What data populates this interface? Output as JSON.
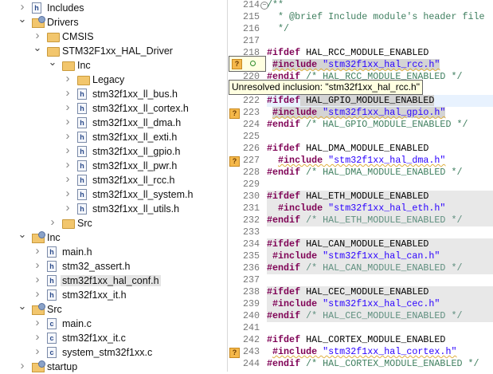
{
  "tree": [
    {
      "label": "Includes",
      "level": 0,
      "expanded": false,
      "icon": "includes-icon"
    },
    {
      "label": "Drivers",
      "level": 0,
      "expanded": true,
      "icon": "source-folder-icon"
    },
    {
      "label": "CMSIS",
      "level": 1,
      "expanded": false,
      "icon": "folder-icon"
    },
    {
      "label": "STM32F1xx_HAL_Driver",
      "level": 1,
      "expanded": true,
      "icon": "folder-icon"
    },
    {
      "label": "Inc",
      "level": 2,
      "expanded": true,
      "icon": "folder-icon"
    },
    {
      "label": "Legacy",
      "level": 3,
      "expanded": false,
      "icon": "folder-icon"
    },
    {
      "label": "stm32f1xx_ll_bus.h",
      "level": 3,
      "expanded": false,
      "icon": "header-file-icon"
    },
    {
      "label": "stm32f1xx_ll_cortex.h",
      "level": 3,
      "expanded": false,
      "icon": "header-file-icon"
    },
    {
      "label": "stm32f1xx_ll_dma.h",
      "level": 3,
      "expanded": false,
      "icon": "header-file-icon"
    },
    {
      "label": "stm32f1xx_ll_exti.h",
      "level": 3,
      "expanded": false,
      "icon": "header-file-icon"
    },
    {
      "label": "stm32f1xx_ll_gpio.h",
      "level": 3,
      "expanded": false,
      "icon": "header-file-icon"
    },
    {
      "label": "stm32f1xx_ll_pwr.h",
      "level": 3,
      "expanded": false,
      "icon": "header-file-icon"
    },
    {
      "label": "stm32f1xx_ll_rcc.h",
      "level": 3,
      "expanded": false,
      "icon": "header-file-icon"
    },
    {
      "label": "stm32f1xx_ll_system.h",
      "level": 3,
      "expanded": false,
      "icon": "header-file-icon"
    },
    {
      "label": "stm32f1xx_ll_utils.h",
      "level": 3,
      "expanded": false,
      "icon": "header-file-icon"
    },
    {
      "label": "Src",
      "level": 2,
      "expanded": false,
      "icon": "folder-icon"
    },
    {
      "label": "Inc",
      "level": 0,
      "expanded": true,
      "icon": "source-folder-icon"
    },
    {
      "label": "main.h",
      "level": 1,
      "expanded": false,
      "icon": "header-file-icon"
    },
    {
      "label": "stm32_assert.h",
      "level": 1,
      "expanded": false,
      "icon": "header-file-icon"
    },
    {
      "label": "stm32f1xx_hal_conf.h",
      "level": 1,
      "expanded": false,
      "icon": "header-file-icon",
      "selected": true
    },
    {
      "label": "stm32f1xx_it.h",
      "level": 1,
      "expanded": false,
      "icon": "header-file-icon"
    },
    {
      "label": "Src",
      "level": 0,
      "expanded": true,
      "icon": "source-folder-icon"
    },
    {
      "label": "main.c",
      "level": 1,
      "expanded": false,
      "icon": "c-file-icon"
    },
    {
      "label": "stm32f1xx_it.c",
      "level": 1,
      "expanded": false,
      "icon": "c-file-icon"
    },
    {
      "label": "system_stm32f1xx.c",
      "level": 1,
      "expanded": false,
      "icon": "c-file-icon"
    },
    {
      "label": "startup",
      "level": 0,
      "expanded": false,
      "icon": "source-folder-icon"
    }
  ],
  "editor": {
    "lines": [
      {
        "n": "214",
        "parts": [
          [
            "cm",
            "/**"
          ]
        ],
        "fold": true
      },
      {
        "n": "215",
        "parts": [
          [
            "cm",
            "  * @brief Include module's header file"
          ]
        ]
      },
      {
        "n": "216",
        "parts": [
          [
            "cm",
            "  */"
          ]
        ]
      },
      {
        "n": "217",
        "parts": []
      },
      {
        "n": "218",
        "parts": [
          [
            "kw",
            "#ifdef"
          ],
          [
            "mac",
            " HAL_RCC_MODULE_ENABLED"
          ]
        ]
      },
      {
        "n": "219",
        "parts": [
          [
            "mac",
            " "
          ],
          [
            "kw occ warn",
            "#include"
          ],
          [
            "str occ warn",
            " \"stm32f1xx_hal_rcc.h\""
          ]
        ],
        "warn": true
      },
      {
        "n": "220",
        "parts": [
          [
            "kw",
            "#endif"
          ],
          [
            "cm",
            " /* HAL_RCC_MODULE_ENABLED */"
          ]
        ]
      },
      {
        "n": "221",
        "parts": []
      },
      {
        "n": "222",
        "parts": [
          [
            "kw",
            "#ifdef"
          ],
          [
            "mac occ",
            " HAL_GPIO_MODULE_ENABLED"
          ]
        ],
        "cur": true
      },
      {
        "n": "223",
        "parts": [
          [
            "mac",
            " "
          ],
          [
            "kw occ warn",
            "#include"
          ],
          [
            "str occ warn",
            " \"stm32f1xx_hal_gpio.h\""
          ]
        ],
        "warn": true
      },
      {
        "n": "224",
        "parts": [
          [
            "kw",
            "#endif"
          ],
          [
            "cm",
            " /* HAL_GPIO_MODULE_ENABLED */"
          ]
        ]
      },
      {
        "n": "225",
        "parts": []
      },
      {
        "n": "226",
        "parts": [
          [
            "kw",
            "#ifdef"
          ],
          [
            "mac",
            " HAL_DMA_MODULE_ENABLED"
          ]
        ]
      },
      {
        "n": "227",
        "parts": [
          [
            "mac",
            "  "
          ],
          [
            "kw warn",
            "#include"
          ],
          [
            "str warn",
            " \"stm32f1xx_hal_dma.h\""
          ]
        ],
        "warn": true
      },
      {
        "n": "228",
        "parts": [
          [
            "kw",
            "#endif"
          ],
          [
            "cm",
            " /* HAL_DMA_MODULE_ENABLED */"
          ]
        ]
      },
      {
        "n": "229",
        "parts": []
      },
      {
        "n": "230",
        "parts": [
          [
            "kw",
            "#ifdef"
          ],
          [
            "mac",
            " HAL_ETH_MODULE_ENABLED"
          ]
        ],
        "inactive": true
      },
      {
        "n": "231",
        "parts": [
          [
            "mac",
            "  "
          ],
          [
            "kw",
            "#include"
          ],
          [
            "str",
            " \"stm32f1xx_hal_eth.h\""
          ]
        ],
        "inactive": true
      },
      {
        "n": "232",
        "parts": [
          [
            "kw",
            "#endif"
          ],
          [
            "cm",
            " /* HAL_ETH_MODULE_ENABLED */"
          ]
        ],
        "inactive": true
      },
      {
        "n": "233",
        "parts": []
      },
      {
        "n": "234",
        "parts": [
          [
            "kw",
            "#ifdef"
          ],
          [
            "mac",
            " HAL_CAN_MODULE_ENABLED"
          ]
        ],
        "inactive": true
      },
      {
        "n": "235",
        "parts": [
          [
            "mac",
            " "
          ],
          [
            "kw",
            "#include"
          ],
          [
            "str",
            " \"stm32f1xx_hal_can.h\""
          ]
        ],
        "inactive": true
      },
      {
        "n": "236",
        "parts": [
          [
            "kw",
            "#endif"
          ],
          [
            "cm",
            " /* HAL_CAN_MODULE_ENABLED */"
          ]
        ],
        "inactive": true
      },
      {
        "n": "237",
        "parts": []
      },
      {
        "n": "238",
        "parts": [
          [
            "kw",
            "#ifdef"
          ],
          [
            "mac",
            " HAL_CEC_MODULE_ENABLED"
          ]
        ],
        "inactive": true
      },
      {
        "n": "239",
        "parts": [
          [
            "mac",
            " "
          ],
          [
            "kw",
            "#include"
          ],
          [
            "str",
            " \"stm32f1xx_hal_cec.h\""
          ]
        ],
        "inactive": true
      },
      {
        "n": "240",
        "parts": [
          [
            "kw",
            "#endif"
          ],
          [
            "cm",
            " /* HAL_CEC_MODULE_ENABLED */"
          ]
        ],
        "inactive": true
      },
      {
        "n": "241",
        "parts": []
      },
      {
        "n": "242",
        "parts": [
          [
            "kw",
            "#ifdef"
          ],
          [
            "mac",
            " HAL_CORTEX_MODULE_ENABLED"
          ]
        ]
      },
      {
        "n": "243",
        "parts": [
          [
            "mac",
            " "
          ],
          [
            "kw warn",
            "#include"
          ],
          [
            "str warn",
            " \"stm32f1xx_hal_cortex.h\""
          ]
        ],
        "warn": true
      },
      {
        "n": "244",
        "parts": [
          [
            "kw",
            "#endif"
          ],
          [
            "cm",
            " /* HAL_CORTEX_MODULE_ENABLED */"
          ]
        ]
      }
    ],
    "tooltip": "Unresolved inclusion: \"stm32f1xx_hal_rcc.h\"",
    "warning_marker": "?"
  },
  "colors": {
    "keyword": "#7f0055",
    "string": "#2a00ff",
    "comment": "#3f7f5f",
    "warning": "#f5b84a",
    "inactive_bg": "#e8e8e8"
  }
}
